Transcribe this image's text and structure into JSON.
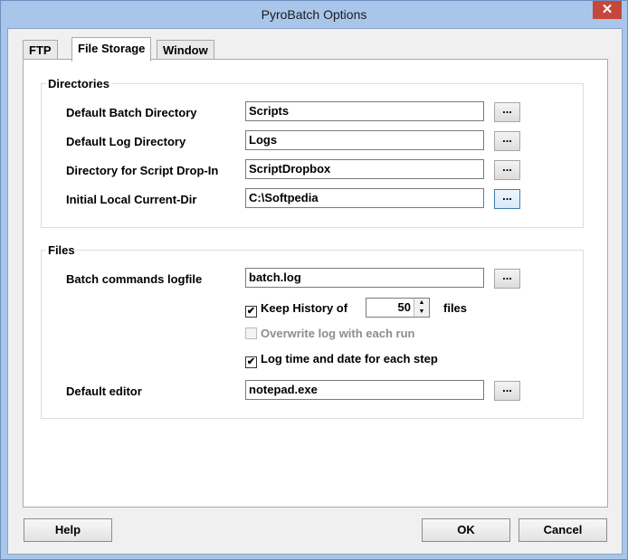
{
  "window": {
    "title": "PyroBatch Options",
    "close_glyph": "✕"
  },
  "tabs": [
    {
      "label": "FTP"
    },
    {
      "label": "File Storage"
    },
    {
      "label": "Window"
    }
  ],
  "directories": {
    "group_label": "Directories",
    "rows": [
      {
        "label": "Default Batch Directory",
        "value": "Scripts"
      },
      {
        "label": "Default Log Directory",
        "value": "Logs"
      },
      {
        "label": "Directory for Script Drop-In",
        "value": "ScriptDropbox"
      },
      {
        "label": "Initial Local Current-Dir",
        "value": "C:\\Softpedia"
      }
    ]
  },
  "files": {
    "group_label": "Files",
    "logfile_label": "Batch commands logfile",
    "logfile_value": "batch.log",
    "keep_history_label": "Keep History of",
    "keep_history_checked": true,
    "keep_history_value": "50",
    "files_unit": "files",
    "overwrite_label": "Overwrite log with each run",
    "overwrite_checked": false,
    "log_time_label": "Log time and date for each step",
    "log_time_checked": true,
    "editor_label": "Default editor",
    "editor_value": "notepad.exe"
  },
  "browse_label": "...",
  "buttons": {
    "help": "Help",
    "ok": "OK",
    "cancel": "Cancel"
  }
}
